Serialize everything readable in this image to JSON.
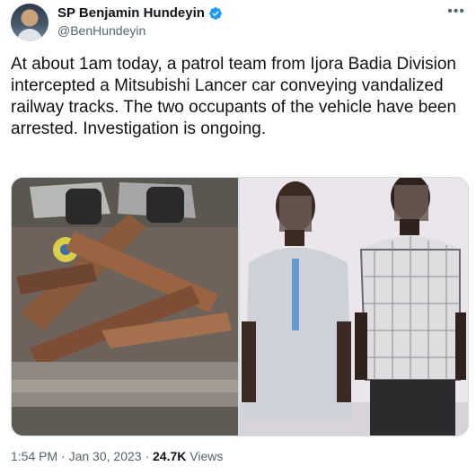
{
  "author": {
    "name": "SP Benjamin Hundeyin",
    "handle": "@BenHundeyin",
    "verified_badge": "verified-badge-icon"
  },
  "tweet": {
    "text": "At about 1am today, a patrol team from Ijora Badia Division intercepted a Mitsubishi Lancer car conveying vandalized railway tracks. The two occupants of the vehicle have been arrested. Investigation is ongoing."
  },
  "meta": {
    "time": "1:54 PM",
    "sep1": " · ",
    "date": "Jan 30, 2023",
    "sep2": " · ",
    "views_count": "24.7K",
    "views_label": " Views"
  },
  "colors": {
    "accent": "#1d9bf0",
    "text": "#0f1419",
    "muted": "#536471"
  }
}
